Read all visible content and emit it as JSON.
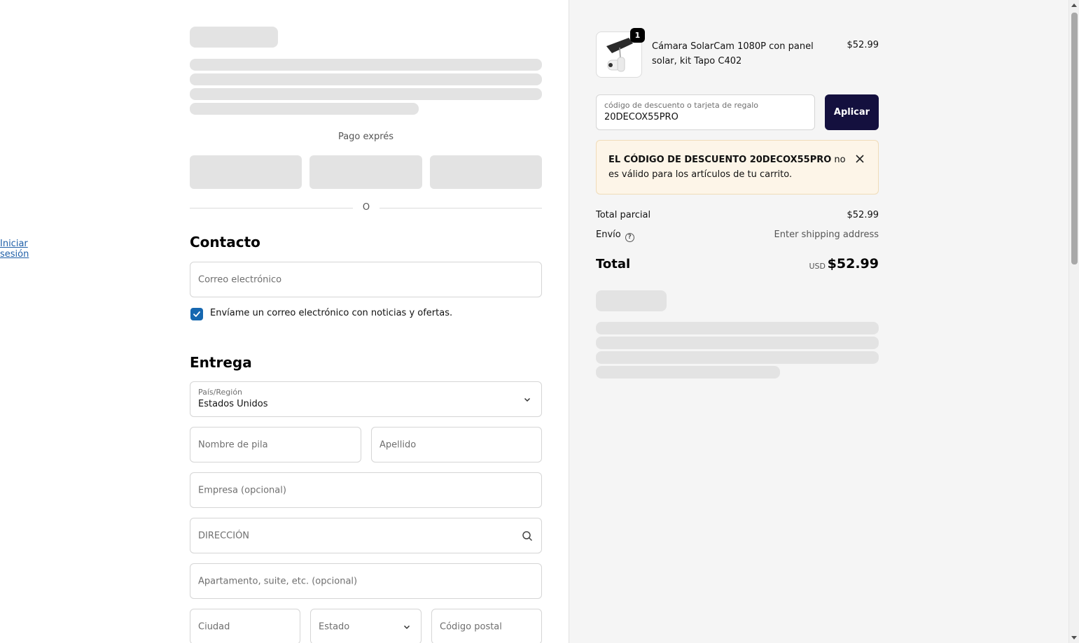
{
  "express": {
    "label": "Pago exprés",
    "divider": "O"
  },
  "contact": {
    "title": "Contacto",
    "login_link": "Iniciar sesión",
    "email_placeholder": "Correo electrónico",
    "newsletter_label": "Envíame un correo electrónico con noticias y ofertas.",
    "newsletter_checked": true
  },
  "delivery": {
    "title": "Entrega",
    "country_label": "País/Región",
    "country_value": "Estados Unidos",
    "first_name_placeholder": "Nombre de pila",
    "last_name_placeholder": "Apellido",
    "company_placeholder": "Empresa (opcional)",
    "address_placeholder": "DIRECCIÓN",
    "apartment_placeholder": "Apartamento, suite, etc. (opcional)",
    "city_placeholder": "Ciudad",
    "state_placeholder": "Estado",
    "zip_placeholder": "Código postal"
  },
  "cart": {
    "item": {
      "quantity": "1",
      "name": "Cámara SolarCam 1080P con panel solar, kit Tapo C402",
      "price": "$52.99"
    },
    "discount": {
      "label": "código de descuento o tarjeta de regalo",
      "value": "20DECOX55PRO",
      "apply_label": "Aplicar"
    },
    "alert": {
      "bold": "EL CÓDIGO DE DESCUENTO 20DECOX55PRO",
      "rest": " no es válido para los artículos de tu carrito."
    },
    "subtotal_label": "Total parcial",
    "subtotal_value": "$52.99",
    "shipping_label": "Envío",
    "shipping_value": "Enter shipping address",
    "total_label": "Total",
    "currency": "USD",
    "total_value": "$52.99"
  },
  "colors": {
    "primary_button": "#14103e",
    "checkbox": "#1667b0",
    "link": "#1f5fa8",
    "alert_bg": "#fdf5e8"
  }
}
